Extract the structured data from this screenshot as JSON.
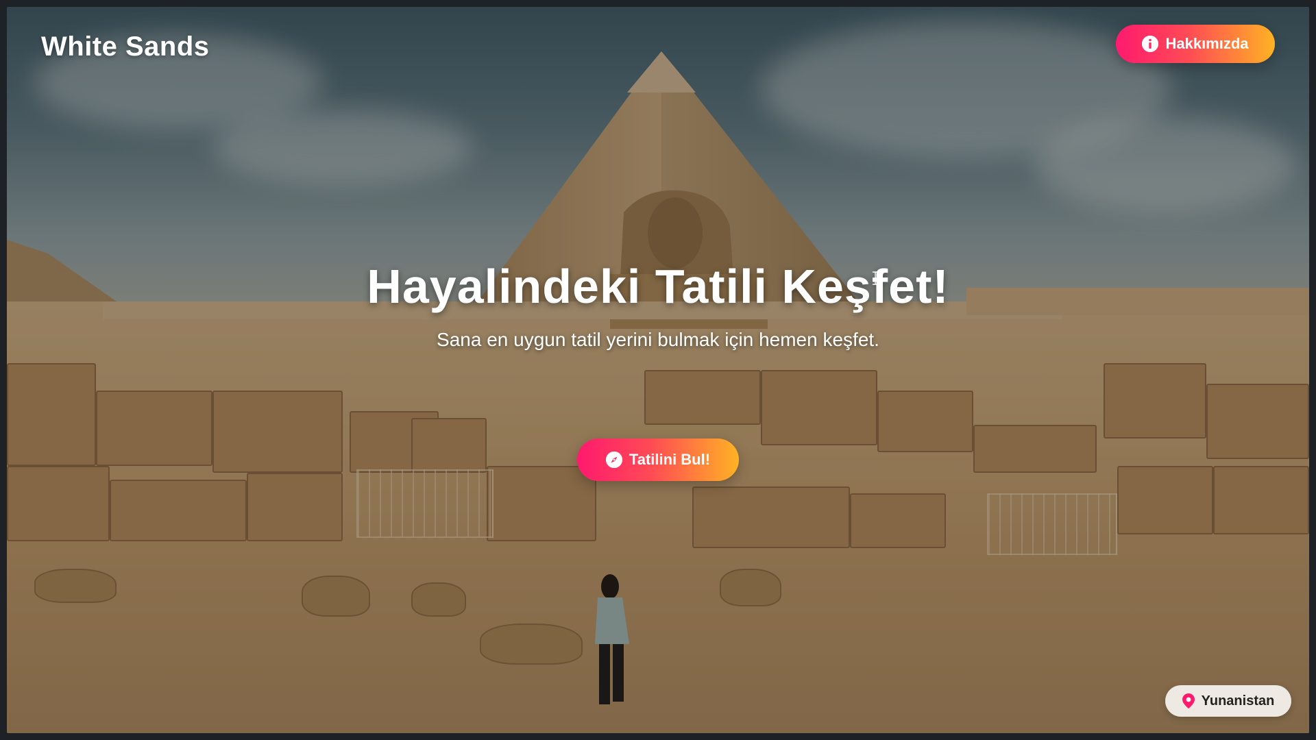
{
  "header": {
    "brand": "White Sands",
    "about_label": "Hakkımızda"
  },
  "hero": {
    "title": "Hayalindeki Tatili Keşfet!",
    "subtitle": "Sana en uygun tatil yerini bulmak için hemen keşfet.",
    "cta_label": "Tatilini Bul!"
  },
  "location": {
    "label": "Yunanistan"
  },
  "icons": {
    "about": "info-icon",
    "cta": "compass-icon",
    "location": "map-pin-icon"
  },
  "colors": {
    "gradient_start": "#ff1a6e",
    "gradient_end": "#ffb224",
    "pin": "#ff1a6e"
  }
}
